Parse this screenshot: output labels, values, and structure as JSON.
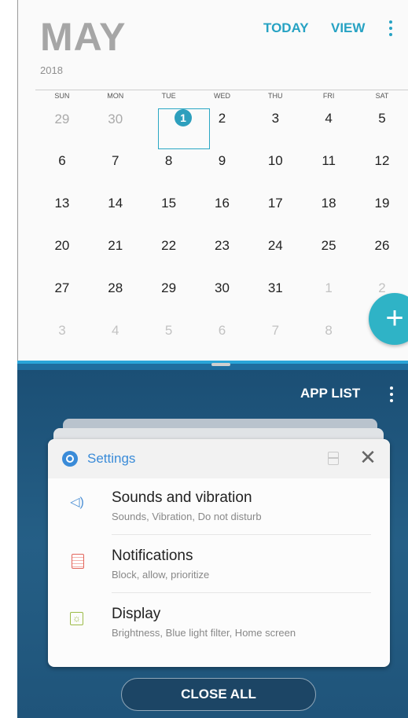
{
  "calendar": {
    "month": "MAY",
    "year": "2018",
    "today_label": "TODAY",
    "view_label": "VIEW",
    "menu_icon": "more-vert-icon",
    "accent_color": "#26a2c3",
    "weekdays": [
      "SUN",
      "MON",
      "TUE",
      "WED",
      "THU",
      "FRI",
      "SAT"
    ],
    "weeks": [
      [
        "29",
        "30",
        "1",
        "2",
        "3",
        "4",
        "5"
      ],
      [
        "6",
        "7",
        "8",
        "9",
        "10",
        "11",
        "12"
      ],
      [
        "13",
        "14",
        "15",
        "16",
        "17",
        "18",
        "19"
      ],
      [
        "20",
        "21",
        "22",
        "23",
        "24",
        "25",
        "26"
      ],
      [
        "27",
        "28",
        "29",
        "30",
        "31",
        "1",
        "2"
      ],
      [
        "3",
        "4",
        "5",
        "6",
        "7",
        "8",
        ""
      ]
    ],
    "selected_day": "1",
    "add_button_icon": "+",
    "fab_color": "#2fb3c6"
  },
  "recents": {
    "app_list_label": "APP LIST",
    "menu_icon": "more-vert-icon",
    "background_color": "#1f5a82",
    "card": {
      "title": "Settings",
      "close_icon": "✕",
      "rows": [
        {
          "title": "Sounds and vibration",
          "subtitle": "Sounds, Vibration, Do not disturb",
          "icon": "speaker-icon",
          "glyph": "◁)"
        },
        {
          "title": "Notifications",
          "subtitle": "Block, allow, prioritize",
          "icon": "notification-icon",
          "glyph": ""
        },
        {
          "title": "Display",
          "subtitle": "Brightness, Blue light filter, Home screen",
          "icon": "display-icon",
          "glyph": "☼"
        }
      ]
    },
    "close_all_label": "CLOSE ALL"
  }
}
